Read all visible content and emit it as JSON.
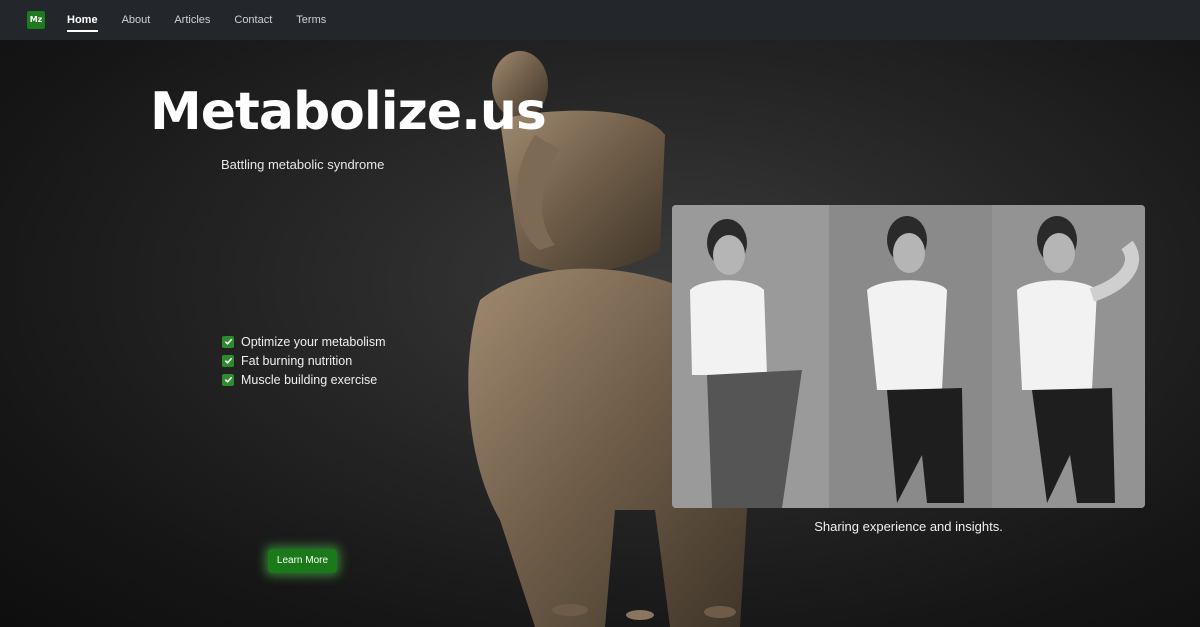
{
  "nav": {
    "logo_text": "Mz",
    "links": [
      {
        "label": "Home",
        "active": true
      },
      {
        "label": "About",
        "active": false
      },
      {
        "label": "Articles",
        "active": false
      },
      {
        "label": "Contact",
        "active": false
      },
      {
        "label": "Terms",
        "active": false
      }
    ]
  },
  "hero": {
    "title": "Metabolize.us",
    "subtitle": "Battling metabolic syndrome",
    "features": [
      "Optimize your metabolism",
      "Fat burning nutrition",
      "Muscle building exercise"
    ],
    "cta_label": "Learn More"
  },
  "photo": {
    "caption": "Sharing experience and insights."
  },
  "colors": {
    "accent": "#1f7a1f",
    "navbar": "#23272b"
  }
}
